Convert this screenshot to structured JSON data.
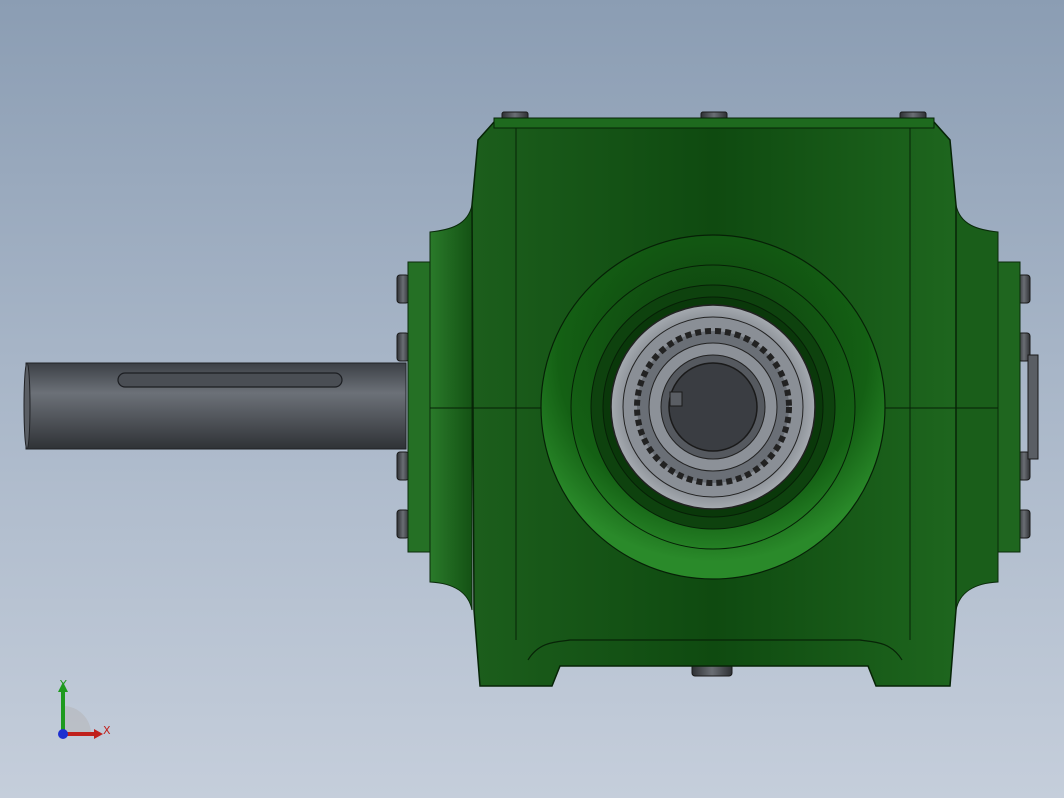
{
  "viewport": {
    "background_top": "#8b9db3",
    "background_bottom": "#c5cedb",
    "model_color": "#1f6a1f",
    "shaft_color": "#4a4e54"
  },
  "triad": {
    "x_label": "X",
    "y_label": "Y",
    "x_color": "#c0201c",
    "y_color": "#1e9a1e",
    "z_color": "#1c2fd0"
  }
}
